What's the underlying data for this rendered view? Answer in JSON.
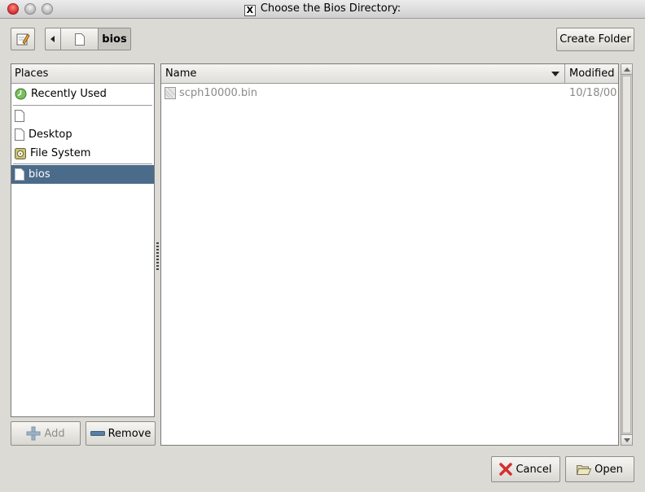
{
  "window": {
    "title": "Choose the Bios Directory:"
  },
  "toolbar": {
    "path_segments": [
      "bios"
    ],
    "create_folder_label": "Create Folder"
  },
  "places": {
    "header": "Places",
    "items": [
      {
        "label": "Recently Used",
        "icon": "recent-icon"
      },
      {
        "label": "",
        "icon": "document-icon"
      },
      {
        "label": "Desktop",
        "icon": "document-icon"
      },
      {
        "label": "File System",
        "icon": "drive-icon"
      },
      {
        "label": "bios",
        "icon": "document-icon",
        "selected": true
      }
    ],
    "add_label": "Add",
    "remove_label": "Remove"
  },
  "files": {
    "columns": {
      "name": "Name",
      "modified": "Modified"
    },
    "rows": [
      {
        "name": "scph10000.bin",
        "modified": "10/18/00"
      }
    ]
  },
  "actions": {
    "cancel_label": "Cancel",
    "open_label": "Open"
  },
  "colors": {
    "selection": "#4b6b8a",
    "window_bg": "#dcdad5"
  }
}
